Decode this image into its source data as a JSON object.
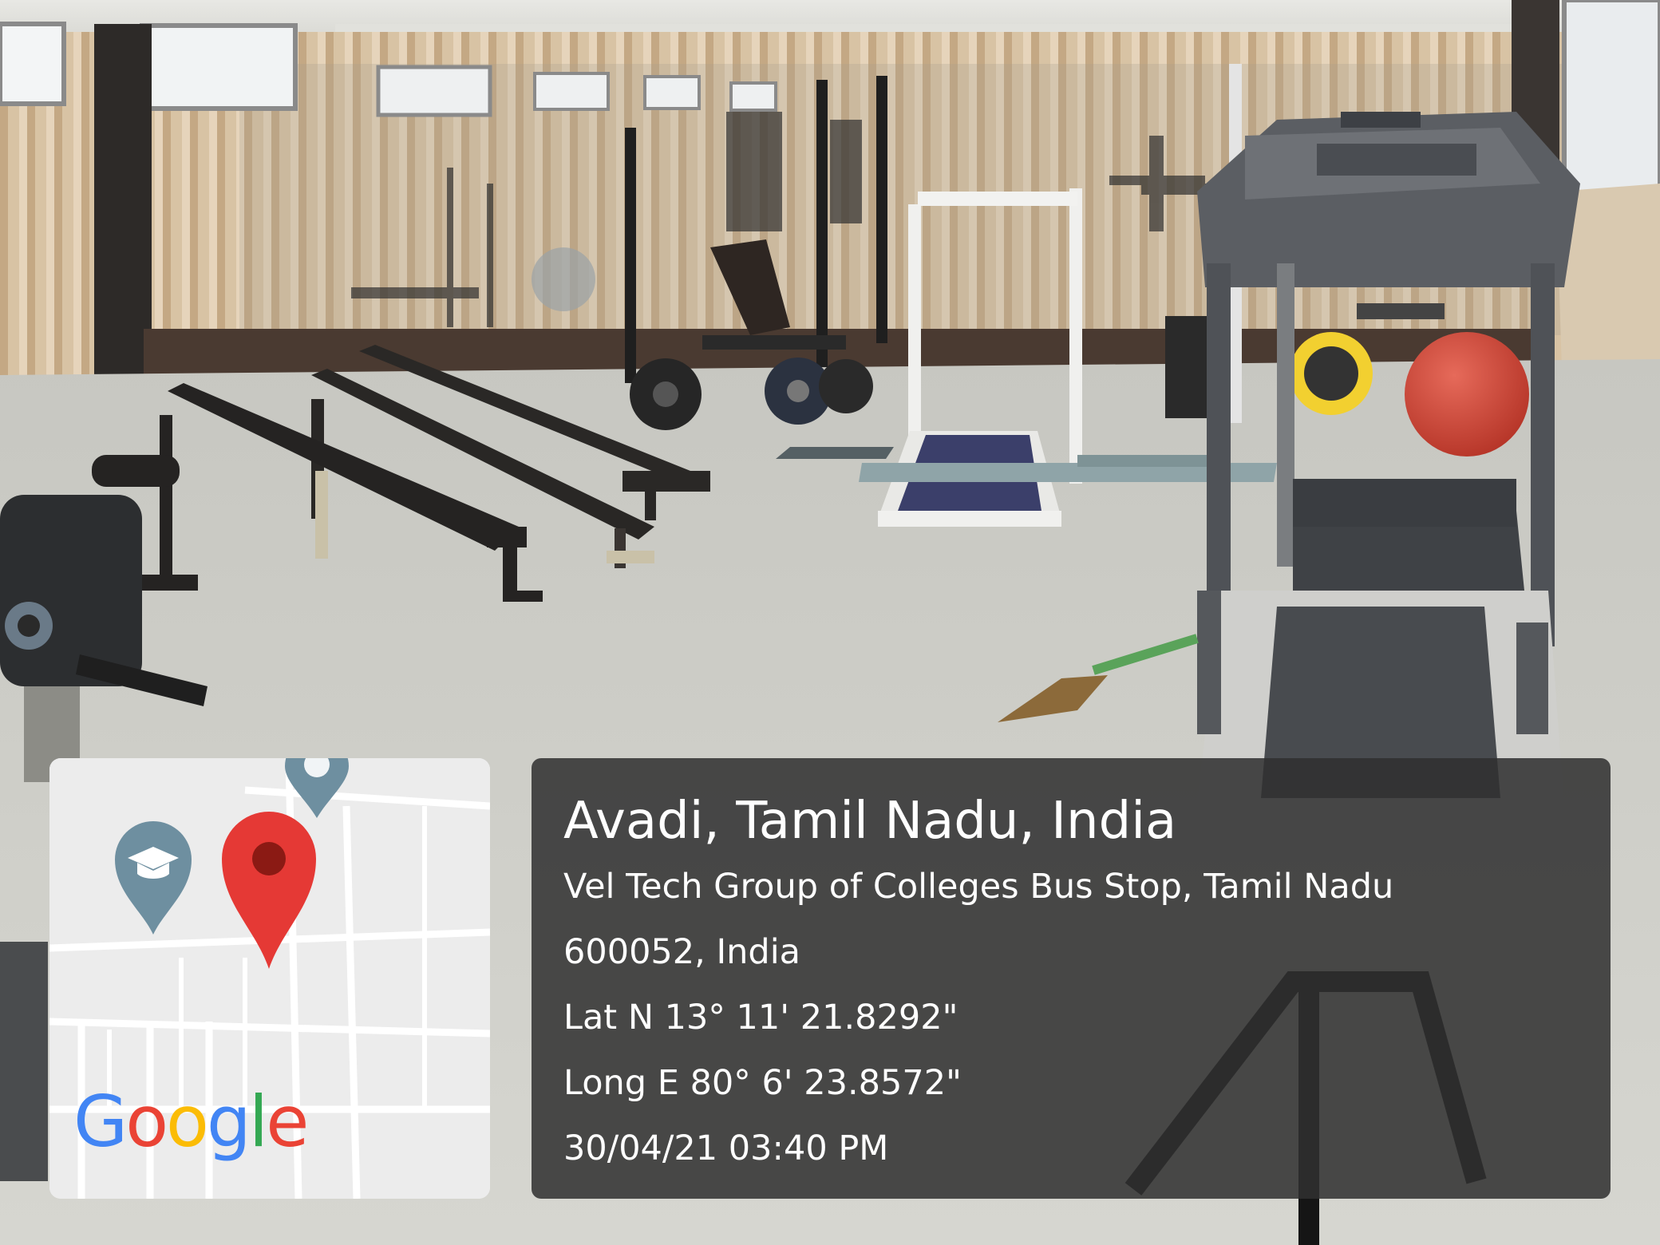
{
  "location": {
    "title": "Avadi, Tamil Nadu, India",
    "address_line1": "Vel Tech Group of Colleges Bus Stop, Tamil Nadu",
    "address_line2": "600052, India",
    "latitude": "Lat N 13° 11' 21.8292\"",
    "longitude": "Long E 80° 6' 23.8572\"",
    "timestamp": "30/04/21 03:40 PM"
  },
  "map": {
    "logo_letters": [
      {
        "char": "G",
        "color": "#4285F4"
      },
      {
        "char": "o",
        "color": "#EA4335"
      },
      {
        "char": "o",
        "color": "#FBBC05"
      },
      {
        "char": "g",
        "color": "#4285F4"
      },
      {
        "char": "l",
        "color": "#34A853"
      },
      {
        "char": "e",
        "color": "#EA4335"
      }
    ],
    "pins": [
      {
        "icon": "location-pin-icon",
        "color": "#E53935"
      },
      {
        "icon": "school-pin-icon",
        "color": "#6E8FA0"
      }
    ]
  },
  "colors": {
    "overlay": "#303030",
    "map_background": "#ececec",
    "floor": "#c9c9c2",
    "wall_panels": "#d8c2a3",
    "ball": "#d64a3c"
  }
}
